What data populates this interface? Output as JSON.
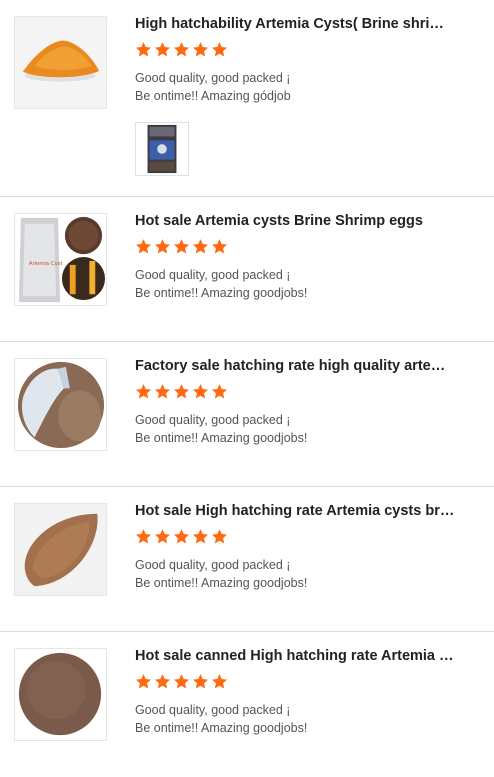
{
  "reviews": [
    {
      "title": "High hatchability Artemia Cysts( Brine shrimp eggs)",
      "rating": 5,
      "line1": "Good quality, good packed ¡",
      "line2": "Be ontime!! Amazing gódjob",
      "image_icon": "orange-powder-heap",
      "has_photo": true,
      "photo_icon": "customer-photo-can"
    },
    {
      "title": "Hot sale Artemia cysts Brine Shrimp eggs",
      "rating": 5,
      "line1": "Good quality, good packed ¡",
      "line2": "Be ontime!! Amazing goodjobs!",
      "image_icon": "artemia-bag-and-eggs"
    },
    {
      "title": "Factory sale hatching rate high quality artemia cysts",
      "rating": 5,
      "line1": "Good quality, good packed ¡",
      "line2": "Be ontime!! Amazing goodjobs!",
      "image_icon": "artemia-pouring-circle"
    },
    {
      "title": "Hot sale High hatching rate Artemia cysts brine shrimp eggs",
      "rating": 5,
      "line1": "Good quality, good packed ¡",
      "line2": "Be ontime!! Amazing goodjobs!",
      "image_icon": "artemia-leaf-pile"
    },
    {
      "title": "Hot sale canned High hatching rate Artemia cysts brine shrimp",
      "rating": 5,
      "line1": "Good quality, good packed ¡",
      "line2": "Be ontime!! Amazing goodjobs!",
      "image_icon": "artemia-round-pile"
    }
  ],
  "colors": {
    "star": "#ff6a13",
    "divider": "#dcdcdc",
    "title": "#222222",
    "comment": "#555555"
  }
}
